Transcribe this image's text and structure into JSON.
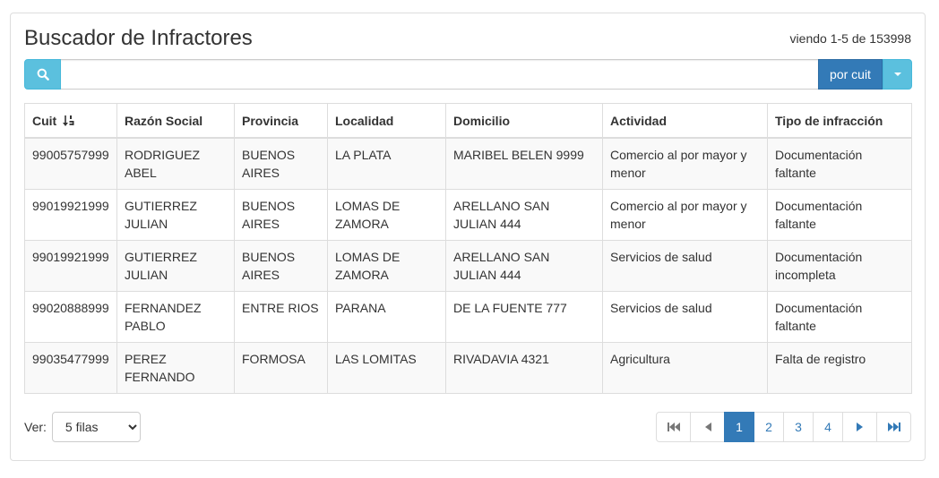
{
  "header": {
    "title": "Buscador de Infractores",
    "count_text": "viendo 1-5 de 153998"
  },
  "search": {
    "value": "",
    "placeholder": "",
    "button_icon": "search-icon",
    "filter_label": "por cuit",
    "dropdown_icon": "caret-down-icon"
  },
  "table": {
    "columns": [
      "Cuit",
      "Razón Social",
      "Provincia",
      "Localidad",
      "Domicilio",
      "Actividad",
      "Tipo de infracción"
    ],
    "sort_icon": "sort-numeric-asc-icon",
    "rows": [
      [
        "99005757999",
        "RODRIGUEZ ABEL",
        "BUENOS AIRES",
        "LA PLATA",
        "MARIBEL BELEN 9999",
        "Comercio al por mayor y menor",
        "Documentación faltante"
      ],
      [
        "99019921999",
        "GUTIERREZ JULIAN",
        "BUENOS AIRES",
        "LOMAS DE ZAMORA",
        "ARELLANO SAN JULIAN 444",
        "Comercio al por mayor y menor",
        "Documentación faltante"
      ],
      [
        "99019921999",
        "GUTIERREZ JULIAN",
        "BUENOS AIRES",
        "LOMAS DE ZAMORA",
        "ARELLANO SAN JULIAN 444",
        "Servicios de salud",
        "Documentación incompleta"
      ],
      [
        "99020888999",
        "FERNANDEZ PABLO",
        "ENTRE RIOS",
        "PARANA",
        "DE LA FUENTE 777",
        "Servicios de salud",
        "Documentación faltante"
      ],
      [
        "99035477999",
        "PEREZ FERNANDO",
        "FORMOSA",
        "LAS LOMITAS",
        "RIVADAVIA 4321",
        "Agricultura",
        "Falta de registro"
      ]
    ]
  },
  "footer": {
    "ver_label": "Ver:",
    "rows_selected": "5 filas",
    "pagination": {
      "pages": [
        "1",
        "2",
        "3",
        "4"
      ],
      "active": "1",
      "icons": [
        "first-page-icon",
        "prev-page-icon",
        "next-page-icon",
        "last-page-icon"
      ]
    }
  },
  "colors": {
    "info": "#5bc0de",
    "primary": "#337ab7",
    "border": "#dddddd",
    "stripe": "#f9f9f9"
  }
}
